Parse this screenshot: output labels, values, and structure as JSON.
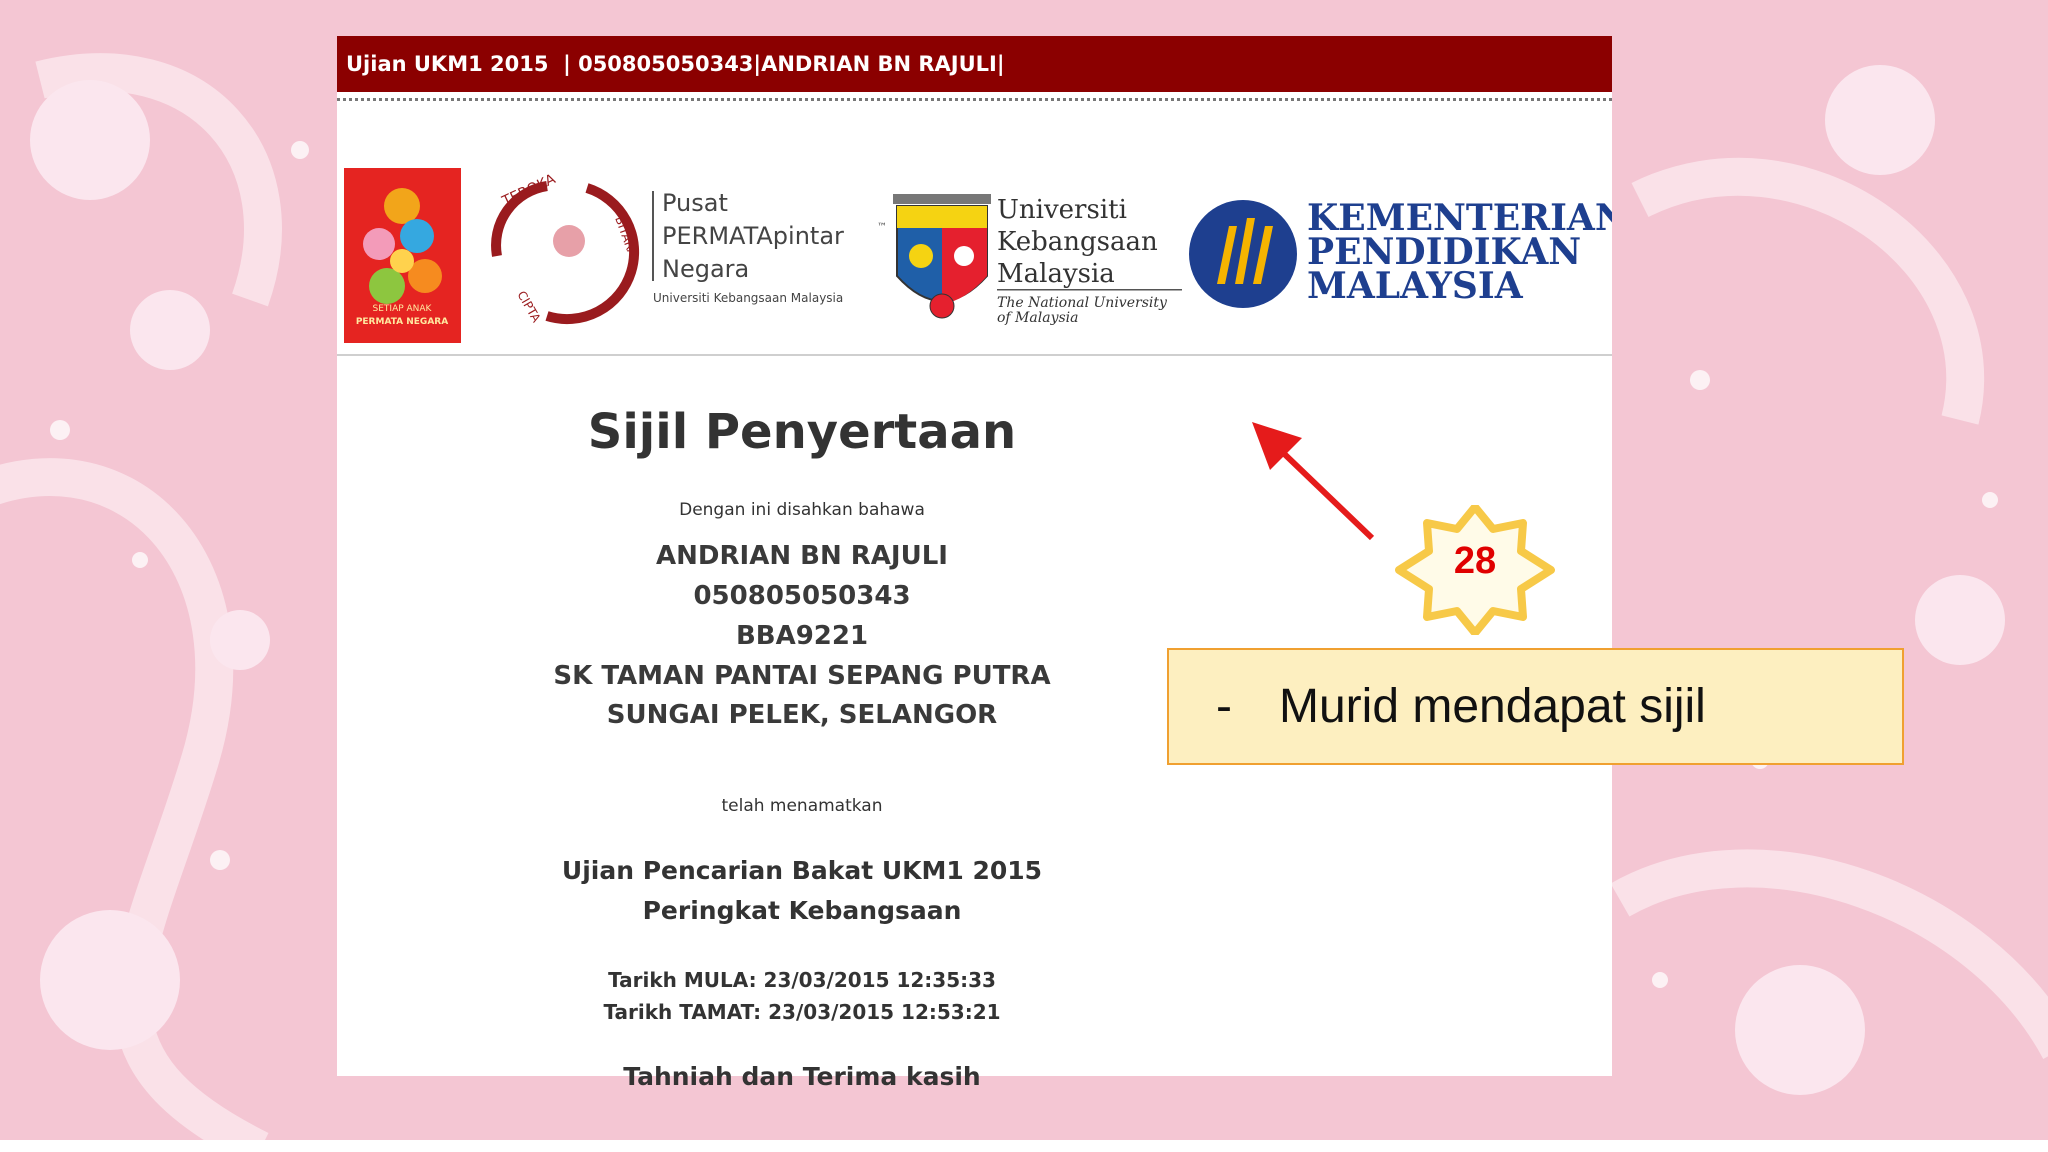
{
  "header": {
    "title_bar": "Ujian UKM1 2015  | 050805050343|ANDRIAN BN RAJULI|"
  },
  "logos": {
    "permata_caption_1": "SETIAP ANAK",
    "permata_caption_2": "PERMATA NEGARA",
    "teroka": "TEROKA",
    "cipta": "CIPTA",
    "bitara": "BITARA",
    "pusat_line1": "Pusat",
    "pusat_line2": "PERMATApintar",
    "pusat_tm": "™",
    "pusat_line3": "Negara",
    "pusat_sub": "Universiti Kebangsaan Malaysia",
    "ukm_line1": "Universiti",
    "ukm_line2": "Kebangsaan",
    "ukm_line3": "Malaysia",
    "ukm_sub1": "The National University",
    "ukm_sub2": "of Malaysia",
    "kpm_line1": "KEMENTERIAN",
    "kpm_line2": "PENDIDIKAN",
    "kpm_line3": "MALAYSIA"
  },
  "certificate": {
    "title": "Sijil Penyertaan",
    "intro": "Dengan ini disahkan bahawa",
    "name": "ANDRIAN BN RAJULI",
    "ic_number": "050805050343",
    "school_code": "BBA9221",
    "school_name": "SK TAMAN PANTAI SEPANG PUTRA",
    "location": "SUNGAI PELEK,  SELANGOR",
    "completed": "telah menamatkan",
    "exam_name": "Ujian Pencarian Bakat UKM1 2015",
    "exam_level": "Peringkat Kebangsaan",
    "start_time": "Tarikh MULA: 23/03/2015 12:35:33",
    "end_time": "Tarikh TAMAT: 23/03/2015 12:53:21",
    "closing": "Tahniah dan Terima kasih"
  },
  "annotation": {
    "step_number": "28",
    "dash": "-",
    "note": "Murid mendapat sijil",
    "badge_color": "#f7c948",
    "arrow_color": "#e51b1b"
  },
  "colors": {
    "title_bar": "#8b0000",
    "callout_bg": "#fdefc0",
    "background": "#f4c6d3"
  }
}
